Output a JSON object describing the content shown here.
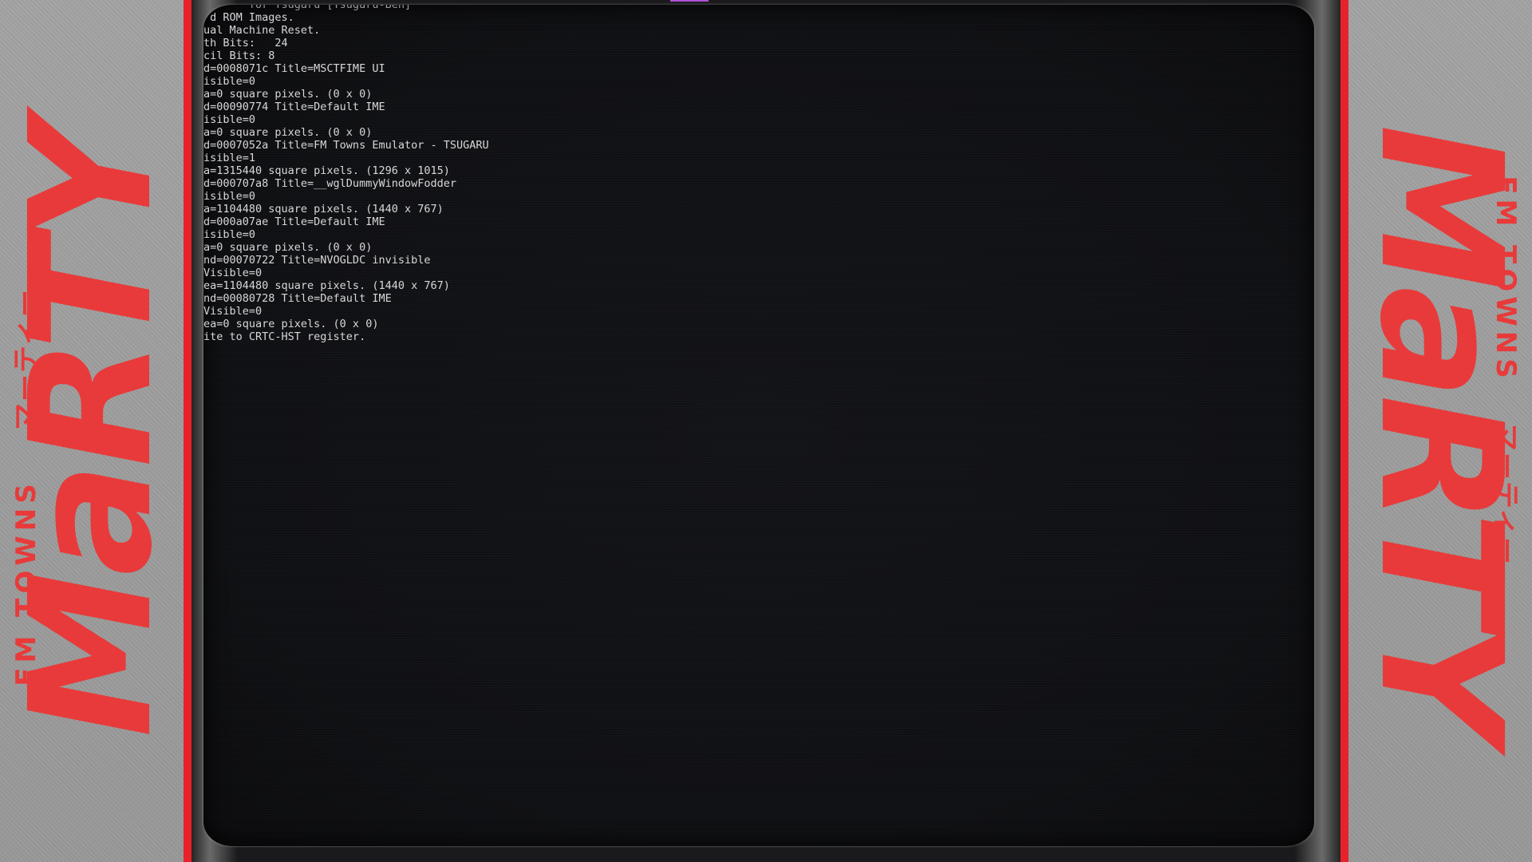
{
  "branding": {
    "marty": "MaRTY",
    "fm_towns": "FM TOWNS",
    "katakana": "マーティー"
  },
  "colors": {
    "brand_red": "#e8222a",
    "logo_red": "#e83a3a",
    "panel_gray": "#9c9c9c",
    "screen_bg": "#101114",
    "console_text": "#d8d8d8",
    "indicator": "#b050d8"
  },
  "console": {
    "lines": [
      "       for Tsugaru [Tsugaru-Ben]",
      " d ROM Images.",
      "ual Machine Reset.",
      "th Bits:   24",
      "cil Bits: 8",
      "d=0008071c Title=MSCTFIME UI",
      "isible=0",
      "a=0 square pixels. (0 x 0)",
      "d=00090774 Title=Default IME",
      "isible=0",
      "a=0 square pixels. (0 x 0)",
      "d=0007052a Title=FM Towns Emulator - TSUGARU",
      "isible=1",
      "a=1315440 square pixels. (1296 x 1015)",
      "d=000707a8 Title=__wglDummyWindowFodder",
      "isible=0",
      "a=1104480 square pixels. (1440 x 767)",
      "d=000a07ae Title=Default IME",
      "isible=0",
      "a=0 square pixels. (0 x 0)",
      "nd=00070722 Title=NVOGLDC invisible",
      "Visible=0",
      "ea=1104480 square pixels. (1440 x 767)",
      "nd=00080728 Title=Default IME",
      "Visible=0",
      "ea=0 square pixels. (0 x 0)",
      "ite to CRTC-HST register."
    ]
  }
}
